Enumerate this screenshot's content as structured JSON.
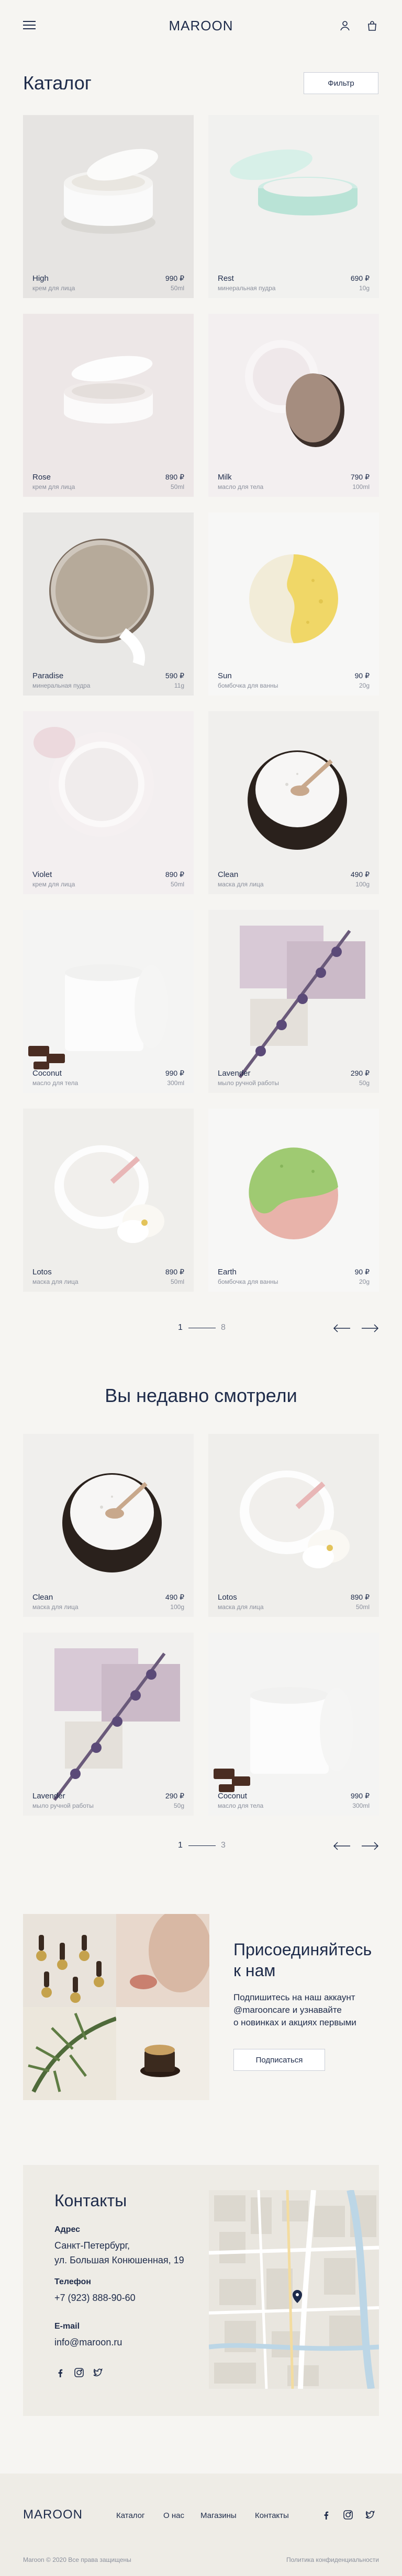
{
  "header": {
    "logo": "MAROON"
  },
  "catalog": {
    "title": "Каталог",
    "filter_label": "Фильтр",
    "products": [
      {
        "name": "High",
        "sub": "крем для лица",
        "price": "990 ₽",
        "amount": "50ml",
        "bg": "#e6e4e2",
        "kind": "jar-white"
      },
      {
        "name": "Rest",
        "sub": "минеральная пудра",
        "price": "690 ₽",
        "amount": "10g",
        "bg": "#f1f1ef",
        "kind": "jar-mint"
      },
      {
        "name": "Rose",
        "sub": "крем для лица",
        "price": "890 ₽",
        "amount": "50ml",
        "bg": "#ede7e7",
        "kind": "jar-open"
      },
      {
        "name": "Milk",
        "sub": "масло для тела",
        "price": "790 ₽",
        "amount": "100ml",
        "bg": "#f3eff0",
        "kind": "jar-brown"
      },
      {
        "name": "Paradise",
        "sub": "минеральная пудра",
        "price": "590 ₽",
        "amount": "11g",
        "bg": "#e9e8e6",
        "kind": "compact"
      },
      {
        "name": "Sun",
        "sub": "бомбочка для ванны",
        "price": "90 ₽",
        "amount": "20g",
        "bg": "#f7f7f6",
        "kind": "bomb-yellow"
      },
      {
        "name": "Violet",
        "sub": "крем для лица",
        "price": "890 ₽",
        "amount": "50ml",
        "bg": "#f3eff0",
        "kind": "cream-top"
      },
      {
        "name": "Clean",
        "sub": "маска для лица",
        "price": "490 ₽",
        "amount": "100g",
        "bg": "#f0efed",
        "kind": "bowl"
      },
      {
        "name": "Coconut",
        "sub": "масло для тела",
        "price": "990 ₽",
        "amount": "300ml",
        "bg": "#f4f4f3",
        "kind": "tub"
      },
      {
        "name": "Lavender",
        "sub": "мыло ручной работы",
        "price": "290 ₽",
        "amount": "50g",
        "bg": "#f1f0ee",
        "kind": "lavender"
      },
      {
        "name": "Lotos",
        "sub": "маска для лица",
        "price": "890 ₽",
        "amount": "50ml",
        "bg": "#efeeeb",
        "kind": "lotos"
      },
      {
        "name": "Earth",
        "sub": "бомбочка для ванны",
        "price": "90 ₽",
        "amount": "20g",
        "bg": "#f7f7f6",
        "kind": "bomb-green"
      }
    ],
    "pager": {
      "current": "1",
      "total": "8"
    }
  },
  "recent": {
    "title": "Вы недавно смотрели",
    "products": [
      {
        "name": "Clean",
        "sub": "маска для лица",
        "price": "490 ₽",
        "amount": "100g",
        "bg": "#f0efed",
        "kind": "bowl"
      },
      {
        "name": "Lotos",
        "sub": "маска для лица",
        "price": "890 ₽",
        "amount": "50ml",
        "bg": "#efeeeb",
        "kind": "lotos"
      },
      {
        "name": "Lavender",
        "sub": "мыло ручной работы",
        "price": "290 ₽",
        "amount": "50g",
        "bg": "#f1f0ee",
        "kind": "lavender"
      },
      {
        "name": "Coconut",
        "sub": "масло для тела",
        "price": "990 ₽",
        "amount": "300ml",
        "bg": "#f4f4f3",
        "kind": "tub"
      }
    ],
    "pager": {
      "current": "1",
      "total": "3"
    }
  },
  "join": {
    "title_line1": "Присоединяйтесь",
    "title_line2": "к нам",
    "text_line1": "Подпишитесь на наш аккаунт",
    "text_line2": "@marooncare и узнавайте",
    "text_line3": "о новинках и акциях первыми",
    "button": "Подписаться"
  },
  "contacts": {
    "title": "Контакты",
    "address_label": "Адрес",
    "address_line1": "Санкт-Петербург,",
    "address_line2": "ул. Большая Конюшенная, 19",
    "phone_label": "Телефон",
    "phone": "+7 (923) 888-90-60",
    "email_label": "E-mail",
    "email": "info@maroon.ru"
  },
  "footer": {
    "logo": "MAROON",
    "nav": [
      "Каталог",
      "О нас",
      "Магазины",
      "Контакты"
    ],
    "copyright": "Maroon © 2020 Все права защищены",
    "privacy": "Политика конфиденциальности"
  },
  "colors": {
    "brand": "#1e2b4a",
    "muted": "#8a8f9c",
    "page_bg": "#f6f5f2"
  }
}
